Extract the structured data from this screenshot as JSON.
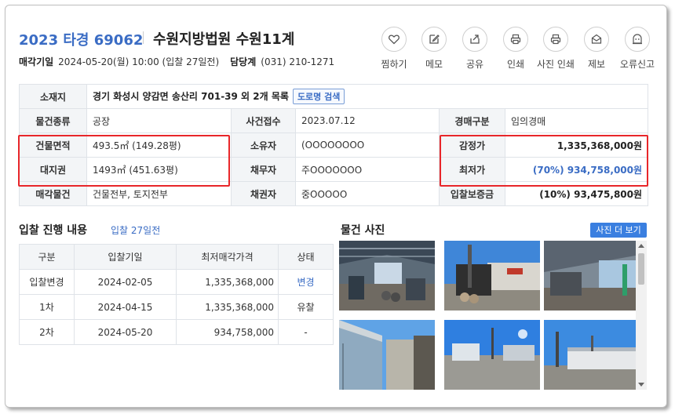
{
  "header": {
    "case_no": "2023 타경 69062",
    "court": "수원지방법원 수원11계",
    "sale_date_label": "매각기일",
    "sale_date": "2024-05-20(월) 10:00 (입찰 27일전)",
    "dept_label": "담당계",
    "dept_phone": "(031) 210-1271"
  },
  "actions": [
    {
      "label": "찜하기",
      "icon": "heart-icon"
    },
    {
      "label": "메모",
      "icon": "memo-icon"
    },
    {
      "label": "공유",
      "icon": "share-icon"
    },
    {
      "label": "인쇄",
      "icon": "print-icon"
    },
    {
      "label": "사진 인쇄",
      "icon": "photo-print-icon"
    },
    {
      "label": "제보",
      "icon": "report-icon"
    },
    {
      "label": "오류신고",
      "icon": "error-report-icon"
    }
  ],
  "info": {
    "location_label": "소재지",
    "location": "경기 화성시 양감면 송산리 701-39 외 2개 목록",
    "road_button": "도로명 검색",
    "type_label": "물건종류",
    "type": "공장",
    "receipt_label": "사건접수",
    "receipt": "2023.07.12",
    "auction_kind_label": "경매구분",
    "auction_kind": "임의경매",
    "building_area_label": "건물면적",
    "building_area": "493.5㎡ (149.28평)",
    "owner_label": "소유자",
    "owner": "(OOOOOOOO",
    "appraisal_label": "감정가",
    "appraisal": "1,335,368,000원",
    "land_label": "대지권",
    "land": "1493㎡ (451.63평)",
    "debtor_label": "채무자",
    "debtor": "주OOOOOOO",
    "min_price_label": "최저가",
    "min_price": "(70%) 934,758,000원",
    "sale_object_label": "매각물건",
    "sale_object": "건물전부, 토지전부",
    "creditor_label": "채권자",
    "creditor": "중OOOOO",
    "deposit_label": "입찰보증금",
    "deposit": "(10%) 93,475,800원"
  },
  "bids": {
    "title": "입찰 진행 내용",
    "note": "입찰 27일전",
    "columns": [
      "구분",
      "입찰기일",
      "최저매각가격",
      "상태"
    ],
    "rows": [
      [
        "입찰변경",
        "2024-02-05",
        "1,335,368,000",
        "변경"
      ],
      [
        "1차",
        "2024-04-15",
        "1,335,368,000",
        "유찰"
      ],
      [
        "2차",
        "2024-05-20",
        "934,758,000",
        "-"
      ]
    ]
  },
  "photos": {
    "title": "물건 사진",
    "more_button": "사진 더 보기"
  },
  "colors": {
    "accent": "#3a6cc4",
    "highlight_box": "#e8262a",
    "button": "#3a7fe0"
  }
}
